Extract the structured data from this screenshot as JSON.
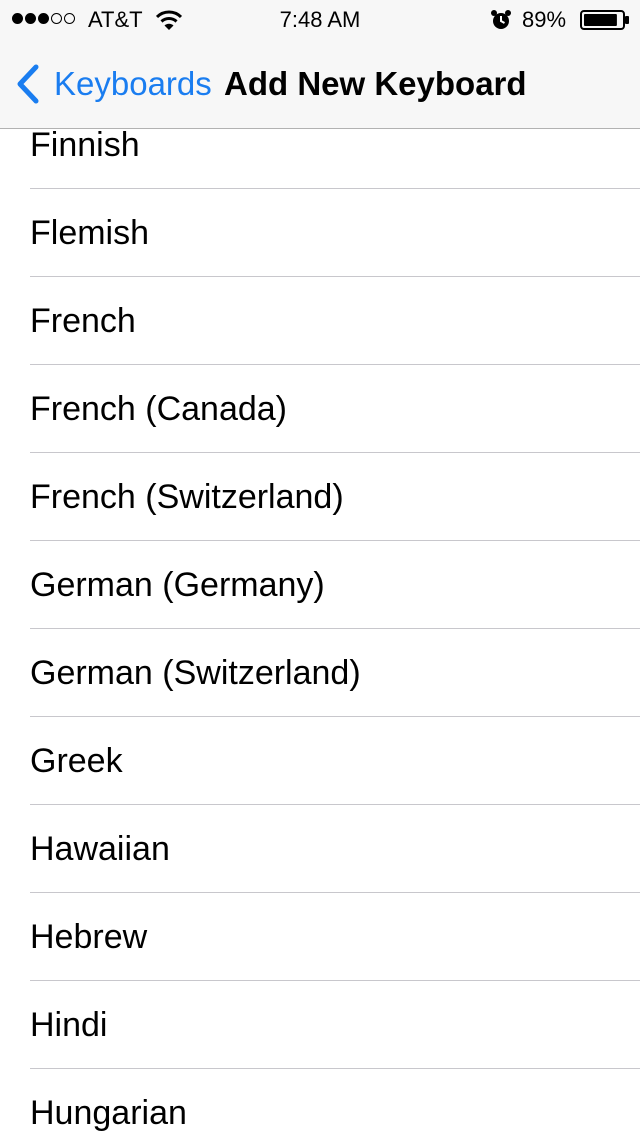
{
  "status_bar": {
    "signal_dots_filled": 3,
    "signal_dots_total": 5,
    "carrier": "AT&T",
    "wifi_icon": "wifi-icon",
    "time": "7:48 AM",
    "alarm_icon": "alarm-icon",
    "battery_percent": "89%",
    "battery_level": 0.89
  },
  "nav": {
    "back_label": "Keyboards",
    "title": "Add New Keyboard"
  },
  "colors": {
    "accent": "#1a7df0",
    "separator": "#c8c7cc",
    "nav_background": "#f7f7f7"
  },
  "languages": [
    {
      "label": "Finnish"
    },
    {
      "label": "Flemish"
    },
    {
      "label": "French"
    },
    {
      "label": "French (Canada)"
    },
    {
      "label": "French (Switzerland)"
    },
    {
      "label": "German (Germany)"
    },
    {
      "label": "German (Switzerland)"
    },
    {
      "label": "Greek"
    },
    {
      "label": "Hawaiian"
    },
    {
      "label": "Hebrew"
    },
    {
      "label": "Hindi"
    },
    {
      "label": "Hungarian"
    }
  ]
}
